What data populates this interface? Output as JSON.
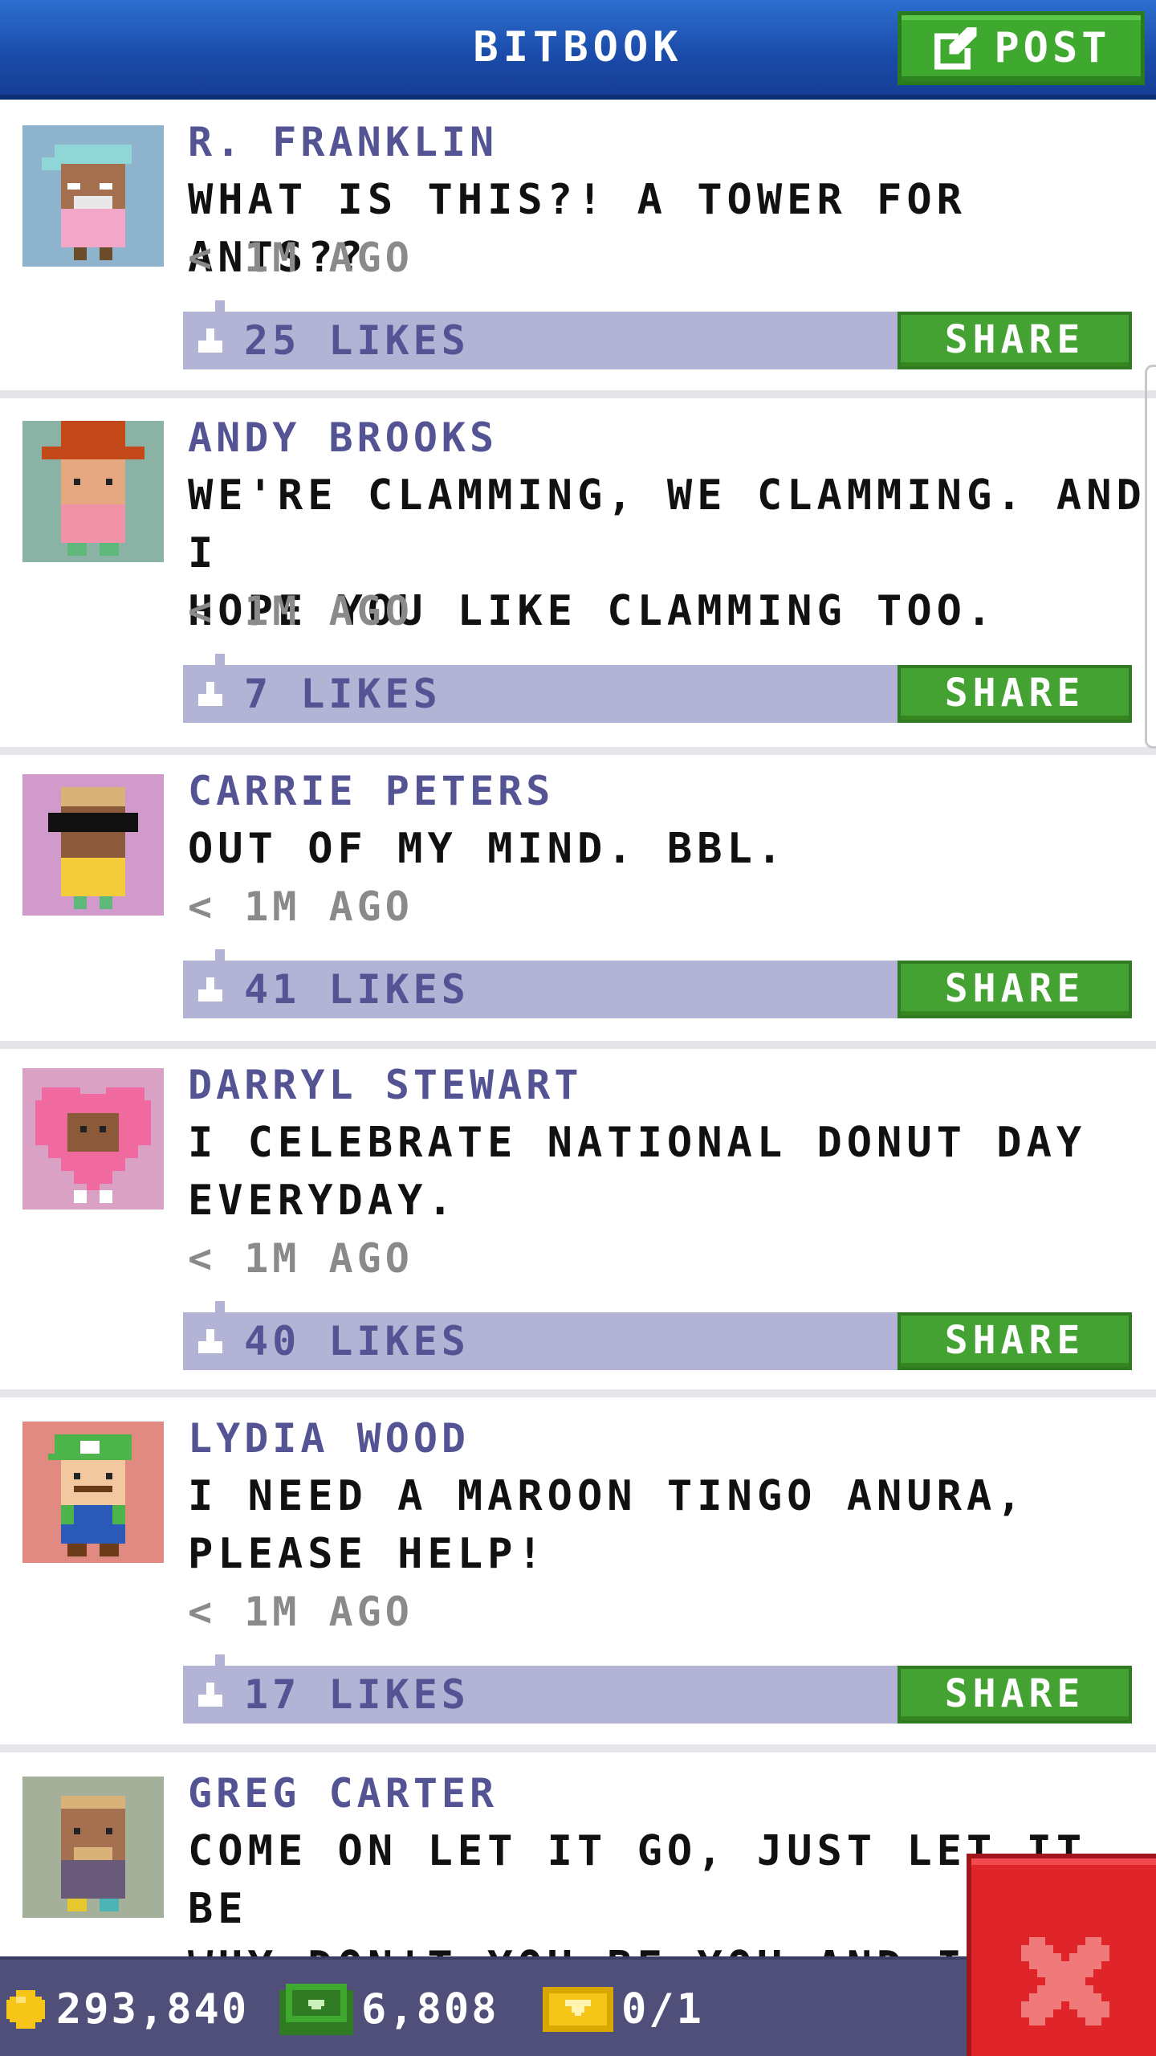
{
  "header": {
    "title": "BITBOOK",
    "post_label": "POST"
  },
  "posts": [
    {
      "author": "R. FRANKLIN",
      "message": "WHAT IS THIS?! A TOWER FOR ANTS??",
      "time": "< 1M AGO",
      "likes": "25 LIKES",
      "share": "SHARE"
    },
    {
      "author": "ANDY BROOKS",
      "message": "WE'RE CLAMMING, WE CLAMMING. AND I\nHOPE YOU LIKE CLAMMING TOO.",
      "time": "< 1M AGO",
      "likes": "7 LIKES",
      "share": "SHARE"
    },
    {
      "author": "CARRIE PETERS",
      "message": "OUT OF MY MIND. BBL.",
      "time": "< 1M AGO",
      "likes": "41 LIKES",
      "share": "SHARE"
    },
    {
      "author": "DARRYL STEWART",
      "message": "I CELEBRATE NATIONAL DONUT DAY\nEVERYDAY.",
      "time": "< 1M AGO",
      "likes": "40 LIKES",
      "share": "SHARE"
    },
    {
      "author": "LYDIA WOOD",
      "message": "I NEED A MAROON TINGO ANURA,\nPLEASE HELP!",
      "time": "< 1M AGO",
      "likes": "17 LIKES",
      "share": "SHARE"
    },
    {
      "author": "GREG CARTER",
      "message": "COME ON LET IT GO, JUST LET IT BE\nWHY DON'T YOU BE YOU AND I'LL BE\nME",
      "time": "",
      "likes": "",
      "share": ""
    }
  ],
  "status_bar": {
    "coins": "293,840",
    "bux": "6,808",
    "tickets": "0/1"
  },
  "colors": {
    "header_blue": "#1a4aa8",
    "post_green": "#3fa82e",
    "author_purple": "#545494",
    "like_bar": "#b3b3d6",
    "close_red": "#e0252a",
    "bottom_bar": "#4f4f7a"
  },
  "icons": {
    "post": "compose-icon",
    "like": "like-icon",
    "coin": "coin-icon",
    "bux": "bux-icon",
    "ticket": "golden-ticket-icon",
    "close": "close-icon"
  }
}
